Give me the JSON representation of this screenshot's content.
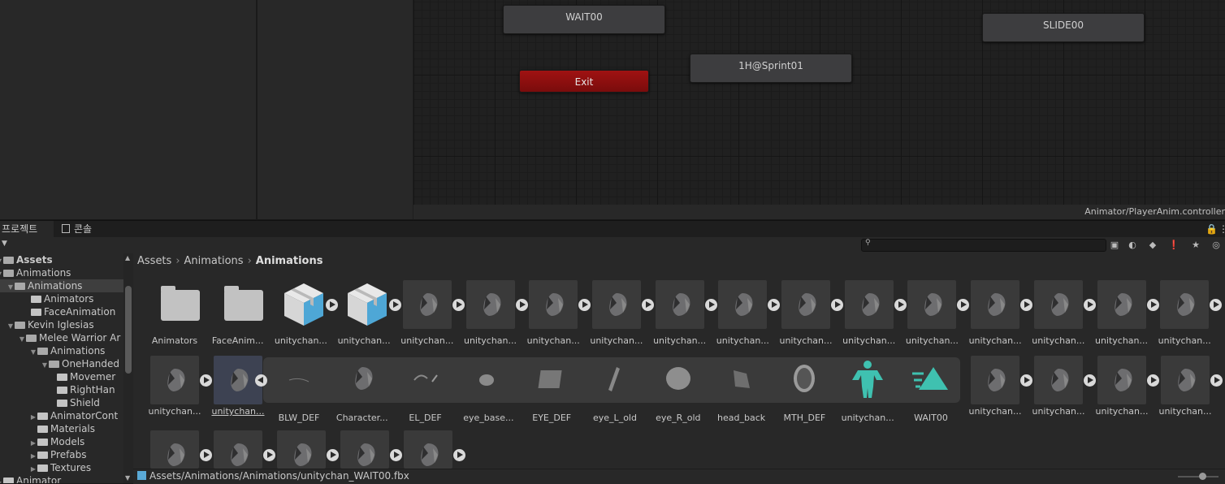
{
  "graph": {
    "nodes": [
      {
        "label": "WAIT00"
      },
      {
        "label": "Exit"
      },
      {
        "label": "1H@Sprint01"
      },
      {
        "label": "SLIDE00"
      }
    ],
    "path": "Animator/PlayerAnim.controller"
  },
  "tabs": {
    "project": "프로젝트",
    "console": "콘솔"
  },
  "tree": [
    {
      "label": "Assets"
    },
    {
      "label": "Animations"
    },
    {
      "label": "Animations"
    },
    {
      "label": "Animators"
    },
    {
      "label": "FaceAnimation"
    },
    {
      "label": "Kevin Iglesias"
    },
    {
      "label": "Melee Warrior Ar"
    },
    {
      "label": "Animations"
    },
    {
      "label": "OneHanded"
    },
    {
      "label": "Movemer"
    },
    {
      "label": "RightHan"
    },
    {
      "label": "Shield"
    },
    {
      "label": "AnimatorCont"
    },
    {
      "label": "Materials"
    },
    {
      "label": "Models"
    },
    {
      "label": "Prefabs"
    },
    {
      "label": "Textures"
    },
    {
      "label": "Animator"
    }
  ],
  "breadcrumb": {
    "a": "Assets",
    "b": "Animations",
    "c": "Animations"
  },
  "row1": [
    {
      "label": "Animators"
    },
    {
      "label": "FaceAnim..."
    },
    {
      "label": "unitychan..."
    },
    {
      "label": "unitychan..."
    },
    {
      "label": "unitychan..."
    },
    {
      "label": "unitychan..."
    },
    {
      "label": "unitychan..."
    },
    {
      "label": "unitychan..."
    },
    {
      "label": "unitychan..."
    },
    {
      "label": "unitychan..."
    },
    {
      "label": "unitychan..."
    },
    {
      "label": "unitychan..."
    },
    {
      "label": "unitychan..."
    },
    {
      "label": "unitychan..."
    },
    {
      "label": "unitychan..."
    },
    {
      "label": "unitychan..."
    },
    {
      "label": "unitychan..."
    }
  ],
  "row2_left": [
    {
      "label": "unitychan..."
    },
    {
      "label": "unitychan..."
    }
  ],
  "row2_sub": [
    {
      "label": "BLW_DEF"
    },
    {
      "label": "Character..."
    },
    {
      "label": "EL_DEF"
    },
    {
      "label": "eye_base..."
    },
    {
      "label": "EYE_DEF"
    },
    {
      "label": "eye_L_old"
    },
    {
      "label": "eye_R_old"
    },
    {
      "label": "head_back"
    },
    {
      "label": "MTH_DEF"
    },
    {
      "label": "unitychan..."
    },
    {
      "label": "WAIT00"
    }
  ],
  "row2_right": [
    {
      "label": "unitychan..."
    },
    {
      "label": "unitychan..."
    },
    {
      "label": "unitychan..."
    },
    {
      "label": "unitychan..."
    }
  ],
  "status": "Assets/Animations/Animations/unitychan_WAIT00.fbx",
  "colors": {
    "exit": "#8e1010",
    "accent_avatar": "#3fc1b0"
  }
}
